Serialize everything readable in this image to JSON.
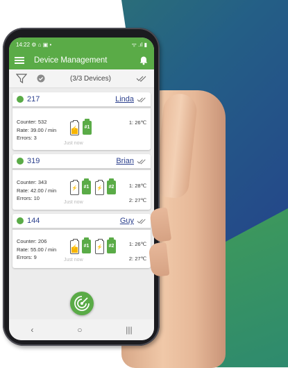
{
  "status": {
    "time": "14:22",
    "left_icons": "⚙ ⌂ ▣ •",
    "right_icons": "ᯤ .ıl ▮"
  },
  "appbar": {
    "title": "Device Management"
  },
  "toolbar": {
    "count": "(3/3 Devices)"
  },
  "devices": [
    {
      "id": "217",
      "user": "Linda",
      "counter": "Counter: 532",
      "rate": "Rate: 39.00 / min",
      "errors": "Errors: 3",
      "updated": "Just now",
      "batteries": [
        {
          "type": "charging",
          "level": 0.45
        },
        {
          "type": "green",
          "label": "#1"
        }
      ],
      "temps": [
        "1: 26℃"
      ]
    },
    {
      "id": "319",
      "user": "Brian",
      "counter": "Counter: 343",
      "rate": "Rate: 42.00 / min",
      "errors": "Errors: 10",
      "updated": "Just now",
      "batteries": [
        {
          "type": "charging",
          "level": 0.0
        },
        {
          "type": "green",
          "label": "#1"
        },
        {
          "type": "charging",
          "level": 0.0
        },
        {
          "type": "green",
          "label": "#2"
        }
      ],
      "temps": [
        "1: 28℃",
        "2: 27℃"
      ]
    },
    {
      "id": "144",
      "user": "Guy",
      "counter": "Counter: 206",
      "rate": "Rate: 55.00 / min",
      "errors": "Errors: 9",
      "updated": "Just now",
      "batteries": [
        {
          "type": "charging",
          "level": 0.45
        },
        {
          "type": "green",
          "label": "#1"
        },
        {
          "type": "charging",
          "level": 0.0
        },
        {
          "type": "green",
          "label": "#2"
        }
      ],
      "temps": [
        "1: 26℃",
        "2: 27℃"
      ]
    }
  ],
  "nav": {
    "back": "‹",
    "home": "○",
    "recent": "|||"
  },
  "colors": {
    "brand_green": "#5aab47",
    "link_blue": "#2b3f8c",
    "battery_yellow": "#f7b500"
  }
}
